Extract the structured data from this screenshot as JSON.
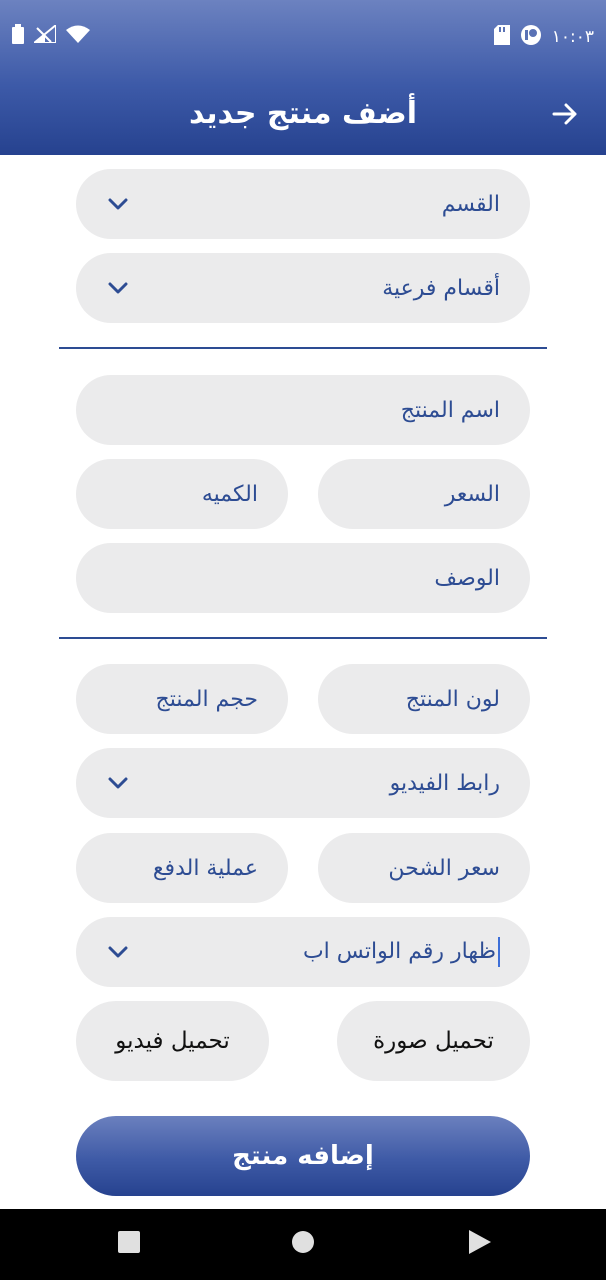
{
  "status_bar": {
    "time": "١٠:٠٣"
  },
  "header": {
    "title": "أضف منتج جديد"
  },
  "category": {
    "label": "القسم"
  },
  "subcategory": {
    "label": "أقسام فرعية"
  },
  "product_name": {
    "label": "اسم المنتج"
  },
  "price": {
    "label": "السعر"
  },
  "quantity": {
    "label": "الكميه"
  },
  "description": {
    "label": "الوصف"
  },
  "product_color": {
    "label": "لون المنتج"
  },
  "product_size": {
    "label": "حجم المنتج"
  },
  "video_link": {
    "label": "رابط الفيديو"
  },
  "shipping_price": {
    "label": "سعر الشحن"
  },
  "payment_method": {
    "label": "عملية الدفع"
  },
  "whatsapp": {
    "label": "ظهار رقم الواتس اب"
  },
  "upload_image": {
    "label": "تحميل صورة"
  },
  "upload_video": {
    "label": "تحميل فيديو"
  },
  "submit": {
    "label": "إضافه منتج"
  },
  "colors": {
    "primary": "#2d4c93",
    "field_bg": "#ebebec",
    "header_top": "#6c82c0",
    "header_bottom": "#26428f"
  }
}
